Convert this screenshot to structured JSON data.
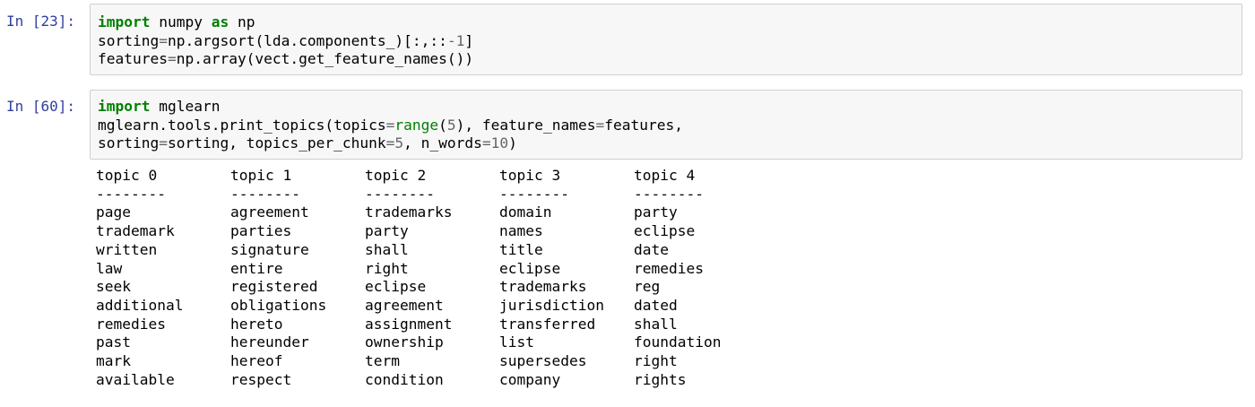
{
  "cells": [
    {
      "prompt": "In [23]:",
      "lines": [
        [
          {
            "t": "import",
            "c": "kw"
          },
          {
            "t": " numpy ",
            "c": "nm"
          },
          {
            "t": "as",
            "c": "kw"
          },
          {
            "t": " np",
            "c": "nm"
          }
        ],
        [
          {
            "t": "sorting",
            "c": "nm"
          },
          {
            "t": "=",
            "c": "op"
          },
          {
            "t": "np.argsort(lda.components_)[:,::",
            "c": "nm"
          },
          {
            "t": "-1",
            "c": "num"
          },
          {
            "t": "]",
            "c": "nm"
          }
        ],
        [
          {
            "t": "features",
            "c": "nm"
          },
          {
            "t": "=",
            "c": "op"
          },
          {
            "t": "np.array(vect.get_feature_names())",
            "c": "nm"
          }
        ]
      ]
    },
    {
      "prompt": "In [60]:",
      "lines": [
        [
          {
            "t": "import",
            "c": "kw"
          },
          {
            "t": " mglearn",
            "c": "nm"
          }
        ],
        [
          {
            "t": "mglearn.tools.print_topics(topics",
            "c": "nm"
          },
          {
            "t": "=",
            "c": "op"
          },
          {
            "t": "range",
            "c": "bi"
          },
          {
            "t": "(",
            "c": "nm"
          },
          {
            "t": "5",
            "c": "num"
          },
          {
            "t": "), feature_names",
            "c": "nm"
          },
          {
            "t": "=",
            "c": "op"
          },
          {
            "t": "features,",
            "c": "nm"
          }
        ],
        [
          {
            "t": "sorting",
            "c": "nm"
          },
          {
            "t": "=",
            "c": "op"
          },
          {
            "t": "sorting, topics_per_chunk",
            "c": "nm"
          },
          {
            "t": "=",
            "c": "op"
          },
          {
            "t": "5",
            "c": "num"
          },
          {
            "t": ", n_words",
            "c": "nm"
          },
          {
            "t": "=",
            "c": "op"
          },
          {
            "t": "10",
            "c": "num"
          },
          {
            "t": ")",
            "c": "nm"
          }
        ]
      ]
    }
  ],
  "output": {
    "separator": "--------",
    "topics": [
      {
        "header": "topic 0",
        "words": [
          "page",
          "trademark",
          "written",
          "law",
          "seek",
          "additional",
          "remedies",
          "past",
          "mark",
          "available"
        ]
      },
      {
        "header": "topic 1",
        "words": [
          "agreement",
          "parties",
          "signature",
          "entire",
          "registered",
          "obligations",
          "hereto",
          "hereunder",
          "hereof",
          "respect"
        ]
      },
      {
        "header": "topic 2",
        "words": [
          "trademarks",
          "party",
          "shall",
          "right",
          "eclipse",
          "agreement",
          "assignment",
          "ownership",
          "term",
          "condition"
        ]
      },
      {
        "header": "topic 3",
        "words": [
          "domain",
          "names",
          "title",
          "eclipse",
          "trademarks",
          "jurisdiction",
          "transferred",
          "list",
          "supersedes",
          "company"
        ]
      },
      {
        "header": "topic 4",
        "words": [
          "party",
          "eclipse",
          "date",
          "remedies",
          "reg",
          "dated",
          "shall",
          "foundation",
          "right",
          "rights"
        ]
      }
    ]
  }
}
